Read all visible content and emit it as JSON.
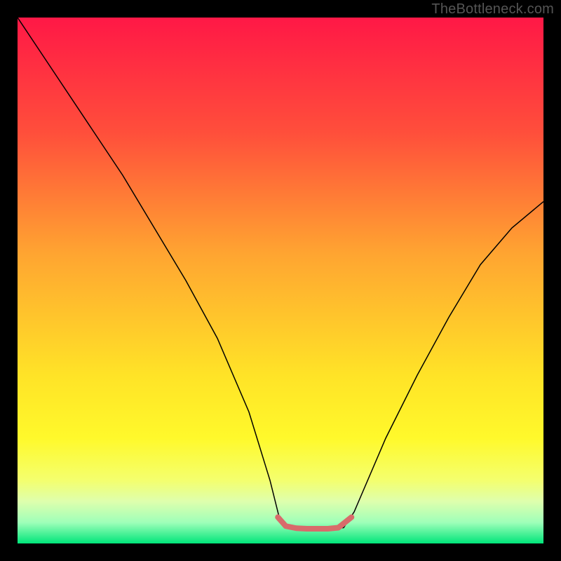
{
  "attribution": "TheBottleneck.com",
  "chart_data": {
    "type": "line",
    "title": "",
    "xlabel": "",
    "ylabel": "",
    "xlim": [
      0,
      100
    ],
    "ylim": [
      0,
      100
    ],
    "grid": false,
    "legend": false,
    "background_gradient_stops": [
      {
        "offset": 0,
        "color": "#ff1846"
      },
      {
        "offset": 22,
        "color": "#ff4f3b"
      },
      {
        "offset": 45,
        "color": "#ffa531"
      },
      {
        "offset": 68,
        "color": "#ffe327"
      },
      {
        "offset": 80,
        "color": "#fff92b"
      },
      {
        "offset": 88,
        "color": "#f4ff6e"
      },
      {
        "offset": 92,
        "color": "#deffad"
      },
      {
        "offset": 96,
        "color": "#9fffb9"
      },
      {
        "offset": 100,
        "color": "#00e57a"
      }
    ],
    "series": [
      {
        "name": "bottleneck-curve",
        "stroke": "#000000",
        "stroke_width": 1.5,
        "x": [
          0,
          4,
          8,
          14,
          20,
          26,
          32,
          38,
          44,
          48,
          50,
          53,
          56,
          59,
          62,
          64,
          70,
          76,
          82,
          88,
          94,
          100
        ],
        "y": [
          100,
          94,
          88,
          79,
          70,
          60,
          50,
          39,
          25,
          12,
          4,
          3,
          2.8,
          2.8,
          3,
          6,
          20,
          32,
          43,
          53,
          60,
          65
        ]
      },
      {
        "name": "highlight-band",
        "stroke": "#d86b6b",
        "stroke_width": 8,
        "linecap": "round",
        "x": [
          49.5,
          51,
          53,
          55,
          57,
          59,
          61,
          63.5
        ],
        "y": [
          5.0,
          3.3,
          2.9,
          2.8,
          2.8,
          2.8,
          3.0,
          5.0
        ]
      }
    ]
  }
}
